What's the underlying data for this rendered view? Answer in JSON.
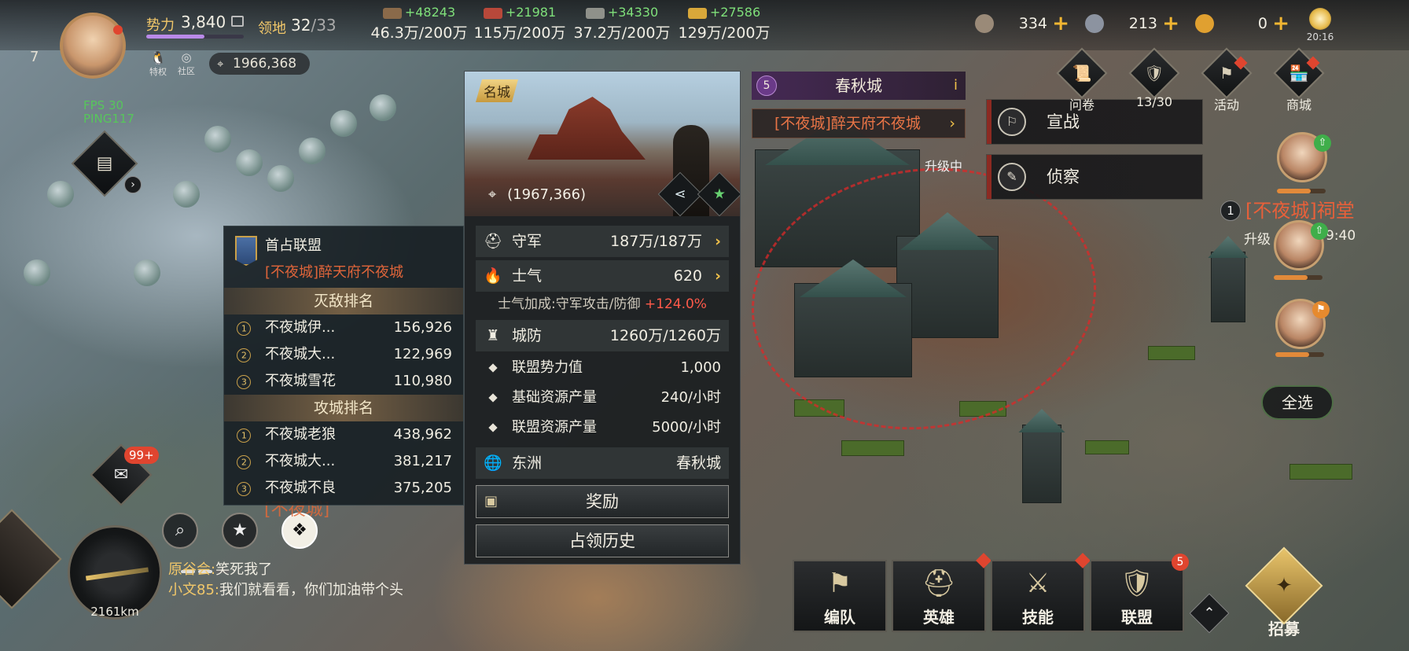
{
  "player": {
    "level": "7",
    "power_label": "势力",
    "power_value": "3,840",
    "power_progress": 0.6,
    "territory_label": "领地",
    "territory_value": "32",
    "territory_max": "/33",
    "privilege_label": "特权",
    "community_label": "社区",
    "coords": "1966,368",
    "fps_label": "FPS 30",
    "ping_label": "PING117"
  },
  "resources": [
    {
      "gain": "+48243",
      "amount": "46.3万/200万",
      "color": "#8a6a4a"
    },
    {
      "gain": "+21981",
      "amount": "115万/200万",
      "color": "#b8483a"
    },
    {
      "gain": "+34330",
      "amount": "37.2万/200万",
      "color": "#8f918a"
    },
    {
      "gain": "+27586",
      "amount": "129万/200万",
      "color": "#d8a83a"
    }
  ],
  "currencies": [
    {
      "value": "334",
      "color": "#9a8a78"
    },
    {
      "value": "213",
      "color": "#8c93a0"
    },
    {
      "value": "0",
      "color": "#e0a030"
    }
  ],
  "clock": "20:16",
  "city_panel": {
    "tag": "名城",
    "coords": "(1967,366)",
    "garrison_label": "守军",
    "garrison_value": "187万/187万",
    "morale_label": "士气",
    "morale_value": "620",
    "morale_bonus_text": "士气加成:守军攻击/防御",
    "morale_bonus_pct": "+124.0%",
    "defense_label": "城防",
    "defense_value": "1260万/1260万",
    "alliance_power_label": "联盟势力值",
    "alliance_power_value": "1,000",
    "base_res_label": "基础资源产量",
    "base_res_value": "240/小时",
    "alliance_res_label": "联盟资源产量",
    "alliance_res_value": "5000/小时",
    "region_label": "东洲",
    "region_value": "春秋城",
    "reward_button": "奖励",
    "history_button": "占领历史"
  },
  "rank_panel": {
    "first_alliance_label": "首占联盟",
    "first_alliance_name": "[不夜城]醉天府不夜城",
    "kill_title": "灭敌排名",
    "kill_rows": [
      {
        "rank": "1",
        "name": "不夜城伊...",
        "score": "156,926"
      },
      {
        "rank": "2",
        "name": "不夜城大...",
        "score": "122,969"
      },
      {
        "rank": "3",
        "name": "不夜城雪花",
        "score": "110,980"
      }
    ],
    "siege_title": "攻城排名",
    "siege_rows": [
      {
        "rank": "1",
        "name": "不夜城老狼",
        "score": "438,962"
      },
      {
        "rank": "2",
        "name": "不夜城大...",
        "score": "381,217"
      },
      {
        "rank": "3",
        "name": "不夜城不良",
        "score": "375,205"
      }
    ]
  },
  "city_banner": {
    "level": "5",
    "name": "春秋城",
    "owner": "[不夜城]醉天府不夜城"
  },
  "context_menu": {
    "declare_war": "宣战",
    "scout": "侦察"
  },
  "right_menu": [
    {
      "label": "问卷",
      "icon": "📜"
    },
    {
      "label": "13/30",
      "icon": "🛡"
    },
    {
      "label": "活动",
      "icon": "⚑"
    },
    {
      "label": "商城",
      "icon": "🏪"
    }
  ],
  "upgrading_label": "升级中",
  "upgrading_label2": "升级",
  "upgrade_timer": "9:40",
  "ancestral_hall": {
    "num": "1",
    "name": "[不夜城]祠堂"
  },
  "select_all": "全选",
  "mail_badge": "99+",
  "compass_distance": "2161km",
  "chat": [
    {
      "who": "原谷会:",
      "text": "笑死我了"
    },
    {
      "who": "小文85:",
      "text": "我们就看看，你们加油带个头"
    }
  ],
  "bottom_menu": [
    {
      "label": "编队",
      "icon": "⚑",
      "badge": ""
    },
    {
      "label": "英雄",
      "icon": "⛑",
      "badge": "dot"
    },
    {
      "label": "技能",
      "icon": "⚔",
      "badge": "dot"
    },
    {
      "label": "联盟",
      "icon": "🛡",
      "badge": "5"
    }
  ],
  "recruit_label": "招募"
}
